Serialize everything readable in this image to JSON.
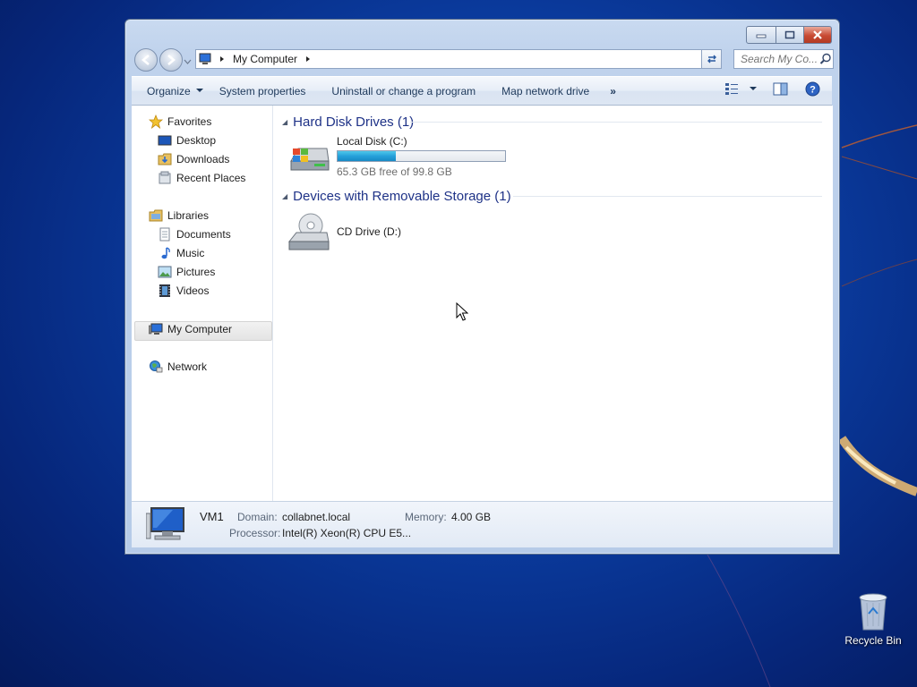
{
  "window": {
    "address_path": "My Computer",
    "search_placeholder": "Search My Co..."
  },
  "toolbar": {
    "organize": "Organize",
    "system_properties": "System properties",
    "uninstall": "Uninstall or change a program",
    "map_network": "Map network drive",
    "more": "»"
  },
  "nav": {
    "favorites": "Favorites",
    "desktop": "Desktop",
    "downloads": "Downloads",
    "recent_places": "Recent Places",
    "libraries": "Libraries",
    "documents": "Documents",
    "music": "Music",
    "pictures": "Pictures",
    "videos": "Videos",
    "my_computer": "My Computer",
    "network": "Network"
  },
  "groups": {
    "hard_disk": "Hard Disk Drives (1)",
    "removable": "Devices with Removable Storage (1)"
  },
  "drives": {
    "c_name": "Local Disk (C:)",
    "c_free": "65.3 GB free of 99.8 GB",
    "c_used_fraction": 0.346,
    "d_name": "CD Drive (D:)"
  },
  "details": {
    "computer_name": "VM1",
    "domain_label": "Domain:",
    "domain_value": "collabnet.local",
    "memory_label": "Memory:",
    "memory_value": "4.00 GB",
    "processor_label": "Processor:",
    "processor_value": "Intel(R) Xeon(R) CPU E5..."
  },
  "desktop": {
    "recycle_bin": "Recycle Bin"
  },
  "colors": {
    "accent": "#1e3287",
    "bar_fill": "#26a0da"
  }
}
